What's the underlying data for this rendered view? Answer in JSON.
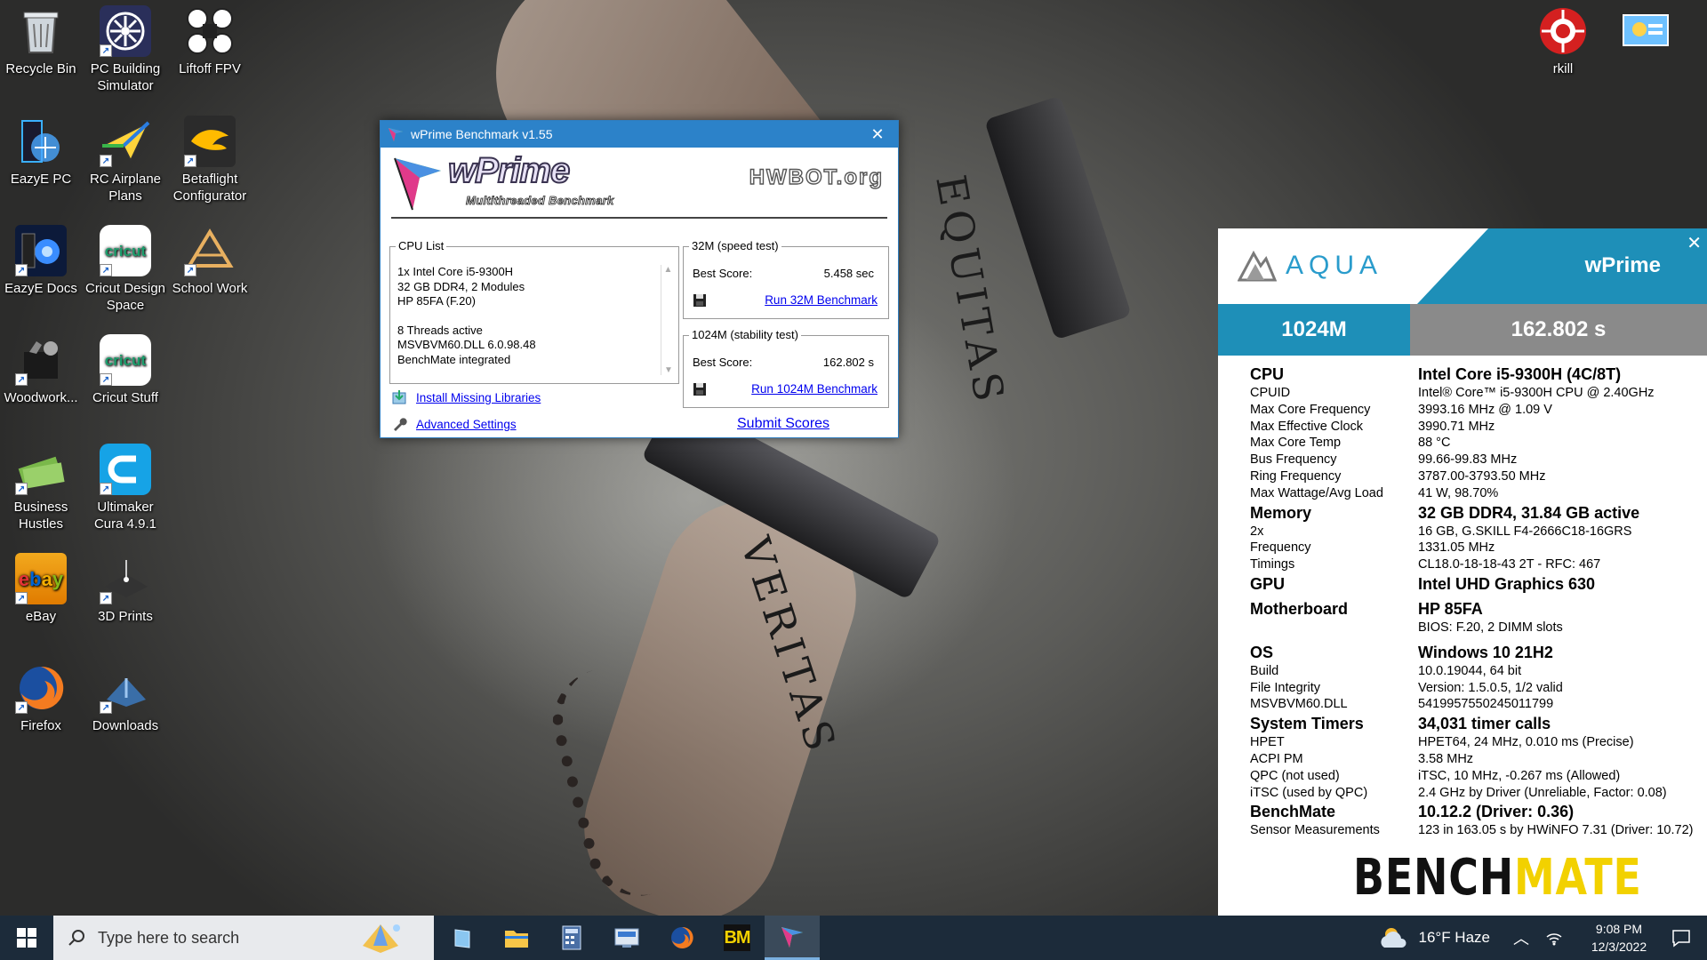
{
  "desktop_icons": [
    {
      "label": "Recycle Bin",
      "icon": "recycle-bin-icon"
    },
    {
      "label": "PC Building Simulator",
      "icon": "pc-building-simulator-icon"
    },
    {
      "label": "Liftoff FPV",
      "icon": "liftoff-fpv-icon"
    },
    {
      "label": "EazyE PC",
      "icon": "eazye-pc-icon"
    },
    {
      "label": "RC Airplane Plans",
      "icon": "rc-airplane-plans-icon"
    },
    {
      "label": "Betaflight Configurator",
      "icon": "betaflight-icon"
    },
    {
      "label": "EazyE Docs",
      "icon": "eazye-docs-icon"
    },
    {
      "label": "Cricut Design Space",
      "icon": "cricut-design-space-icon"
    },
    {
      "label": "School Work",
      "icon": "school-work-icon"
    },
    {
      "label": "Woodwork...",
      "icon": "woodwork-icon"
    },
    {
      "label": "Cricut Stuff",
      "icon": "cricut-stuff-icon"
    },
    {
      "label": "Business Hustles",
      "icon": "business-hustles-icon"
    },
    {
      "label": "Ultimaker Cura 4.9.1",
      "icon": "ultimaker-cura-icon"
    },
    {
      "label": "eBay",
      "icon": "ebay-icon"
    },
    {
      "label": "3D Prints",
      "icon": "3d-prints-icon"
    },
    {
      "label": "Firefox",
      "icon": "firefox-icon"
    },
    {
      "label": "Downloads",
      "icon": "downloads-icon"
    },
    {
      "label": "rkill",
      "icon": "rkill-icon"
    }
  ],
  "wallpaper": {
    "tattoo_top": "EQUITAS",
    "tattoo_bottom": "VERITAS"
  },
  "wprime": {
    "title": "wPrime Benchmark v1.55",
    "logo_text": "wPrime",
    "logo_subtitle": "Multithreaded Benchmark",
    "hwbot_text": "HWBOT.org",
    "cpu_list": {
      "legend": "CPU List",
      "lines": [
        "1x Intel Core i5-9300H",
        "32 GB DDR4, 2 Modules",
        "HP 85FA (F.20)",
        "",
        "8 Threads active",
        "MSVBVM60.DLL 6.0.98.48",
        "BenchMate integrated"
      ]
    },
    "test32": {
      "legend": "32M (speed test)",
      "best_label": "Best Score:",
      "best_value": "5.458 sec",
      "run_label": "Run 32M Benchmark"
    },
    "test1024": {
      "legend": "1024M (stability test)",
      "best_label": "Best Score:",
      "best_value": "162.802 s",
      "run_label": "Run 1024M Benchmark"
    },
    "install_label": "Install Missing Libraries",
    "advanced_label": "Advanced Settings",
    "submit_label": "Submit Scores"
  },
  "aqua": {
    "brand": "AQUA",
    "title": "wPrime",
    "score_label": "1024M",
    "score_value": "162.802 s",
    "sections": [
      {
        "key": "CPU",
        "value": "Intel Core i5-9300H (4C/8T)",
        "rows": [
          [
            "CPUID",
            "Intel® Core™ i5-9300H CPU @ 2.40GHz"
          ],
          [
            "Max Core Frequency",
            "3993.16 MHz @ 1.09 V"
          ],
          [
            "Max Effective Clock",
            "3990.71 MHz"
          ],
          [
            "Max Core Temp",
            "88 °C"
          ],
          [
            "Bus Frequency",
            "99.66-99.83 MHz"
          ],
          [
            "Ring Frequency",
            "3787.00-3793.50 MHz"
          ],
          [
            "Max Wattage/Avg Load",
            "41 W, 98.70%"
          ]
        ]
      },
      {
        "key": "Memory",
        "value": "32 GB DDR4, 31.84 GB active",
        "rows": [
          [
            "2x",
            "16 GB, G.SKILL F4-2666C18-16GRS"
          ],
          [
            "Frequency",
            "1331.05 MHz"
          ],
          [
            "Timings",
            "CL18.0-18-18-43 2T - RFC: 467"
          ]
        ]
      },
      {
        "key": "GPU",
        "value": "Intel UHD Graphics 630",
        "rows": []
      },
      {
        "key": "Motherboard",
        "value": "HP 85FA",
        "rows": [
          [
            "",
            "BIOS: F.20, 2 DIMM slots"
          ]
        ]
      },
      {
        "key": "OS",
        "value": "Windows 10 21H2",
        "rows": [
          [
            "Build",
            "10.0.19044, 64 bit"
          ],
          [
            "File Integrity",
            "Version: 1.5.0.5, 1/2 valid"
          ],
          [
            "MSVBVM60.DLL",
            "5419957550245011799"
          ]
        ]
      },
      {
        "key": "System Timers",
        "value": "34,031 timer calls",
        "rows": [
          [
            "HPET",
            "HPET64, 24 MHz, 0.010 ms (Precise)"
          ],
          [
            "ACPI PM",
            "3.58 MHz"
          ],
          [
            "QPC (not used)",
            "iTSC, 10 MHz, -0.267 ms (Allowed)"
          ],
          [
            "iTSC (used by QPC)",
            "2.4 GHz by Driver (Unreliable, Factor: 0.08)"
          ]
        ]
      },
      {
        "key": "BenchMate",
        "value": "10.12.2 (Driver: 0.36)",
        "rows": [
          [
            "Sensor Measurements",
            "123 in 163.05 s by HWiNFO 7.31 (Driver: 10.72)"
          ]
        ]
      }
    ],
    "logo_bench": "BENCH",
    "logo_mate": "MATE"
  },
  "taskbar": {
    "search_placeholder": "Type here to search",
    "apps": [
      "tablet-mode-icon",
      "file-explorer-icon",
      "calculator-icon",
      "control-panel-icon",
      "firefox-icon",
      "benchmate-icon",
      "wprime-icon"
    ],
    "benchmate_label": "BM",
    "weather": "16°F  Haze",
    "time": "9:08 PM",
    "date": "12/3/2022"
  },
  "colors": {
    "accent": "#1e8fb8",
    "titlebar": "#2c82c9",
    "taskbar": "#1c2b3a",
    "bm_yellow": "#f2d100"
  }
}
